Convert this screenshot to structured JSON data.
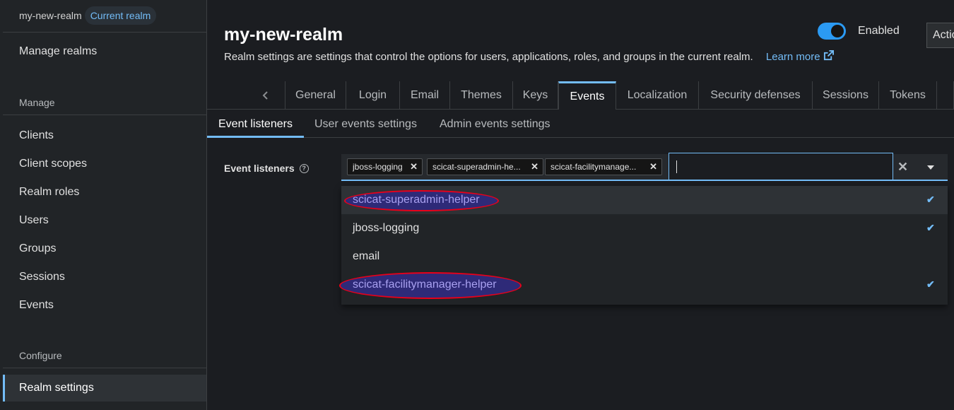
{
  "sidebar": {
    "realm_name": "my-new-realm",
    "realm_badge": "Current realm",
    "manage_realms": "Manage realms",
    "manage_heading": "Manage",
    "items": [
      "Clients",
      "Client scopes",
      "Realm roles",
      "Users",
      "Groups",
      "Sessions",
      "Events"
    ],
    "configure_heading": "Configure",
    "active_item": "Realm settings"
  },
  "header": {
    "title": "my-new-realm",
    "description": "Realm settings are settings that control the options for users, applications, roles, and groups in the current realm.",
    "learn_more": "Learn more",
    "enabled_label": "Enabled",
    "enabled": true,
    "action_label": "Action"
  },
  "tabs": [
    "General",
    "Login",
    "Email",
    "Themes",
    "Keys",
    "Events",
    "Localization",
    "Security defenses",
    "Sessions",
    "Tokens"
  ],
  "active_tab": "Events",
  "subtabs": [
    "Event listeners",
    "User events settings",
    "Admin events settings"
  ],
  "active_subtab": "Event listeners",
  "form": {
    "label": "Event listeners",
    "chips": [
      "jboss-logging",
      "scicat-superadmin-he...",
      "scicat-facilitymanage..."
    ],
    "search_value": "",
    "options": [
      {
        "label": "scicat-superadmin-helper",
        "selected": true,
        "highlighted": true
      },
      {
        "label": "jboss-logging",
        "selected": true,
        "highlighted": false
      },
      {
        "label": "email",
        "selected": false,
        "highlighted": false
      },
      {
        "label": "scicat-facilitymanager-helper",
        "selected": true,
        "highlighted": true
      }
    ]
  },
  "colors": {
    "accent": "#73bcf7",
    "toggle": "#2b9af3",
    "annotation_red": "#e8001a",
    "annotation_fill": "#2e2a78"
  }
}
